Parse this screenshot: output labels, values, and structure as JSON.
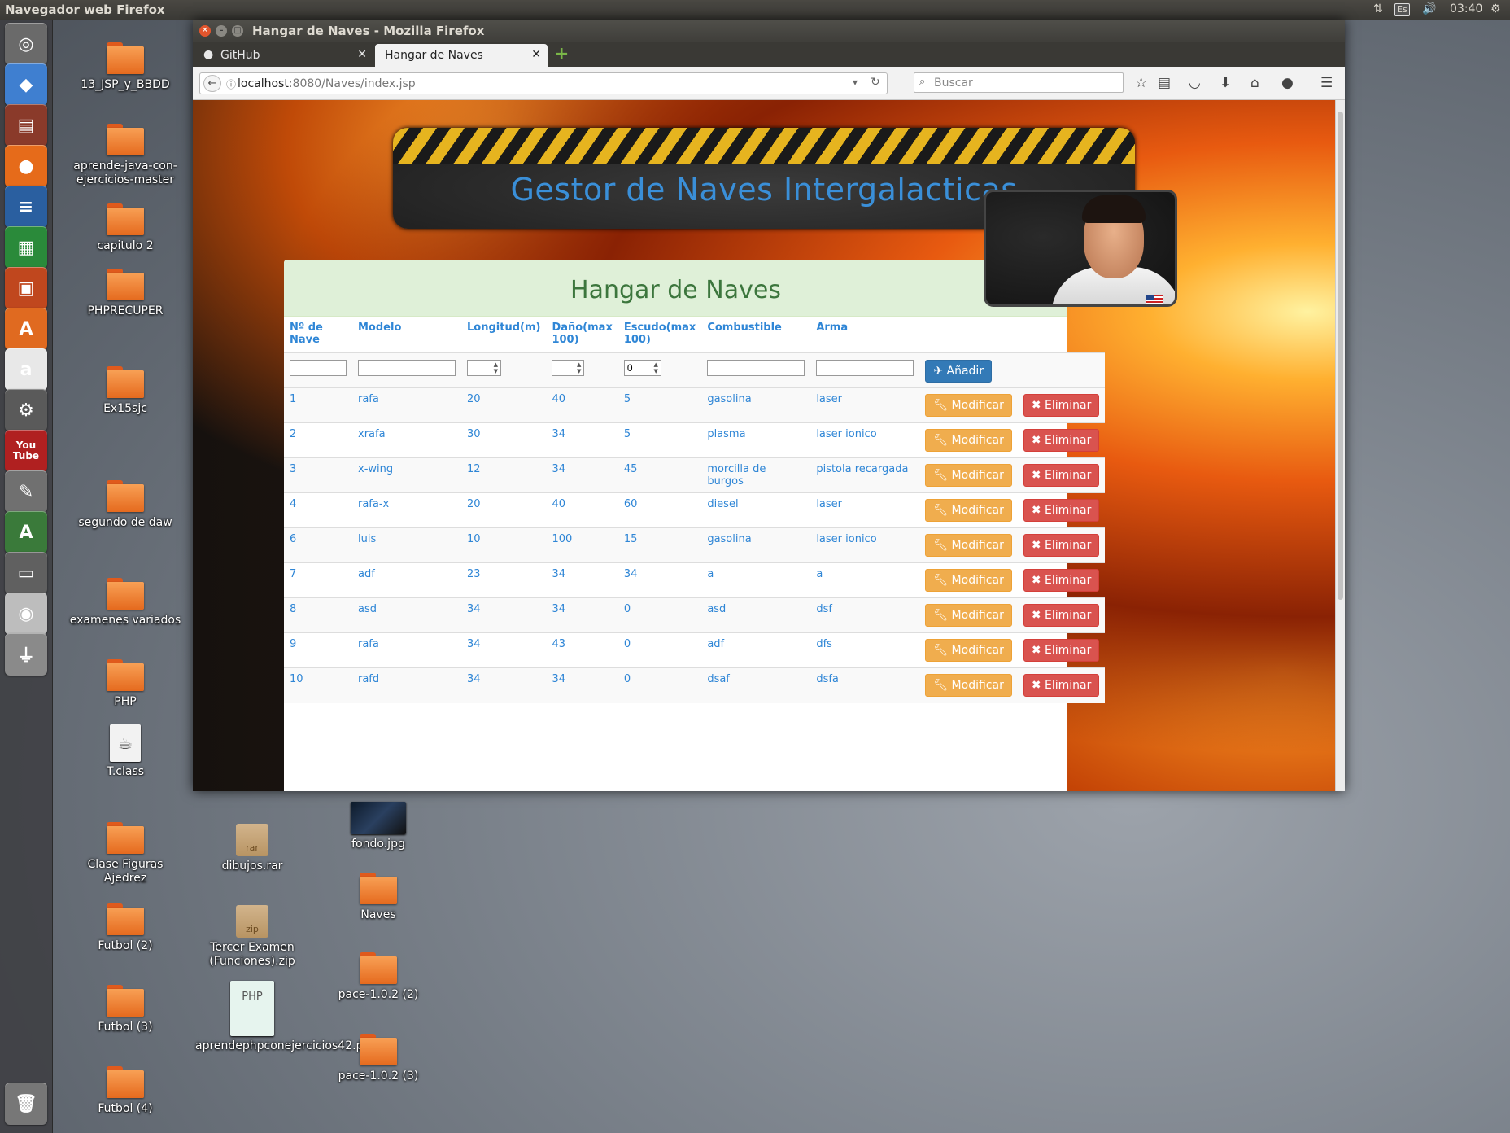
{
  "top_panel": {
    "title": "Navegador web Firefox",
    "keyboard": "Es",
    "time": "03:40"
  },
  "launcher": {
    "items": [
      {
        "name": "dash-icon",
        "glyph": "◎",
        "color": "#6a6a6a"
      },
      {
        "name": "virtualbox-icon",
        "glyph": "◆",
        "color": "#3f7fd0"
      },
      {
        "name": "file-manager-icon",
        "glyph": "▤",
        "color": "#8a3a2a"
      },
      {
        "name": "firefox-icon",
        "glyph": "●",
        "color": "#e66b1a"
      },
      {
        "name": "writer-icon",
        "glyph": "≡",
        "color": "#2a5fa0"
      },
      {
        "name": "calc-icon",
        "glyph": "▦",
        "color": "#2a8a3a"
      },
      {
        "name": "impress-icon",
        "glyph": "▣",
        "color": "#c0471e"
      },
      {
        "name": "software-center-icon",
        "glyph": "A",
        "color": "#e06a20"
      },
      {
        "name": "amazon-icon",
        "glyph": "a",
        "color": "#e8e8e8"
      },
      {
        "name": "system-settings-icon",
        "glyph": "⚙",
        "color": "#5a5a5a"
      },
      {
        "name": "youtube-icon",
        "glyph": "You\nTube",
        "color": "#b02020"
      },
      {
        "name": "gimp-icon",
        "glyph": "✎",
        "color": "#707070"
      },
      {
        "name": "software-updater-icon",
        "glyph": "A",
        "color": "#3a7a3a"
      },
      {
        "name": "save-disk-icon",
        "glyph": "▭",
        "color": "#606060"
      },
      {
        "name": "dvd-icon",
        "glyph": "◉",
        "color": "#bdbdbd"
      },
      {
        "name": "usb-icon",
        "glyph": "⏚",
        "color": "#8a8a8a"
      },
      {
        "name": "trash-icon",
        "glyph": "🗑",
        "color": "#777777"
      }
    ]
  },
  "desktop": {
    "icons": [
      {
        "label": "13_JSP_y_BBDD",
        "type": "folder"
      },
      {
        "label": "aprende-java-con-ejercicios-master",
        "type": "folder"
      },
      {
        "label": "capitulo 2",
        "type": "folder"
      },
      {
        "label": "PHPRECUPER",
        "type": "folder"
      },
      {
        "label": "Ex15sjc",
        "type": "folder"
      },
      {
        "label": "segundo de daw",
        "type": "folder"
      },
      {
        "label": "examenes variados",
        "type": "folder"
      },
      {
        "label": "PHP",
        "type": "folder"
      },
      {
        "label": "T.class",
        "type": "file"
      },
      {
        "label": "Clase Figuras Ajedrez",
        "type": "folder"
      },
      {
        "label": "Futbol (2)",
        "type": "folder"
      },
      {
        "label": "Futbol (3)",
        "type": "folder"
      },
      {
        "label": "Futbol (4)",
        "type": "folder"
      },
      {
        "label": "dibujos.rar",
        "type": "archive",
        "ext": "rar"
      },
      {
        "label": "Tercer Examen (Funciones).zip",
        "type": "archive",
        "ext": "zip"
      },
      {
        "label": "aprendephpconejercicios42.pdf",
        "type": "pdf",
        "thumb": "PHP"
      },
      {
        "label": "fondo.jpg",
        "type": "image"
      },
      {
        "label": "Naves",
        "type": "folder"
      },
      {
        "label": "pace-1.0.2 (2)",
        "type": "folder"
      },
      {
        "label": "pace-1.0.2 (3)",
        "type": "folder"
      }
    ]
  },
  "window": {
    "title": "Hangar de Naves - Mozilla Firefox",
    "tabs": [
      {
        "label": "GitHub",
        "active": false
      },
      {
        "label": "Hangar de Naves",
        "active": true
      }
    ],
    "url_host": "localhost",
    "url_rest": ":8080/Naves/index.jsp",
    "search_placeholder": "Buscar"
  },
  "page": {
    "banner_title": "Gestor de Naves Intergalacticas",
    "panel_title": "Hangar de Naves",
    "columns": [
      "Nº de Nave",
      "Modelo",
      "Longitud(m)",
      "Daño(max 100)",
      "Escudo(max 100)",
      "Combustible",
      "Arma"
    ],
    "escudo_default": "0",
    "add_label": "Añadir",
    "modify_label": "Modificar",
    "delete_label": "Eliminar",
    "rows": [
      [
        "1",
        "rafa",
        "20",
        "40",
        "5",
        "gasolina",
        "laser"
      ],
      [
        "2",
        "xrafa",
        "30",
        "34",
        "5",
        "plasma",
        "laser ionico"
      ],
      [
        "3",
        "x-wing",
        "12",
        "34",
        "45",
        "morcilla de burgos",
        "pistola recargada"
      ],
      [
        "4",
        "rafa-x",
        "20",
        "40",
        "60",
        "diesel",
        "laser"
      ],
      [
        "6",
        "luis",
        "10",
        "100",
        "15",
        "gasolina",
        "laser ionico"
      ],
      [
        "7",
        "adf",
        "23",
        "34",
        "34",
        "a",
        "a"
      ],
      [
        "8",
        "asd",
        "34",
        "34",
        "0",
        "asd",
        "dsf"
      ],
      [
        "9",
        "rafa",
        "34",
        "43",
        "0",
        "adf",
        "dfs"
      ],
      [
        "10",
        "rafd",
        "34",
        "34",
        "0",
        "dsaf",
        "dsfa"
      ]
    ]
  }
}
